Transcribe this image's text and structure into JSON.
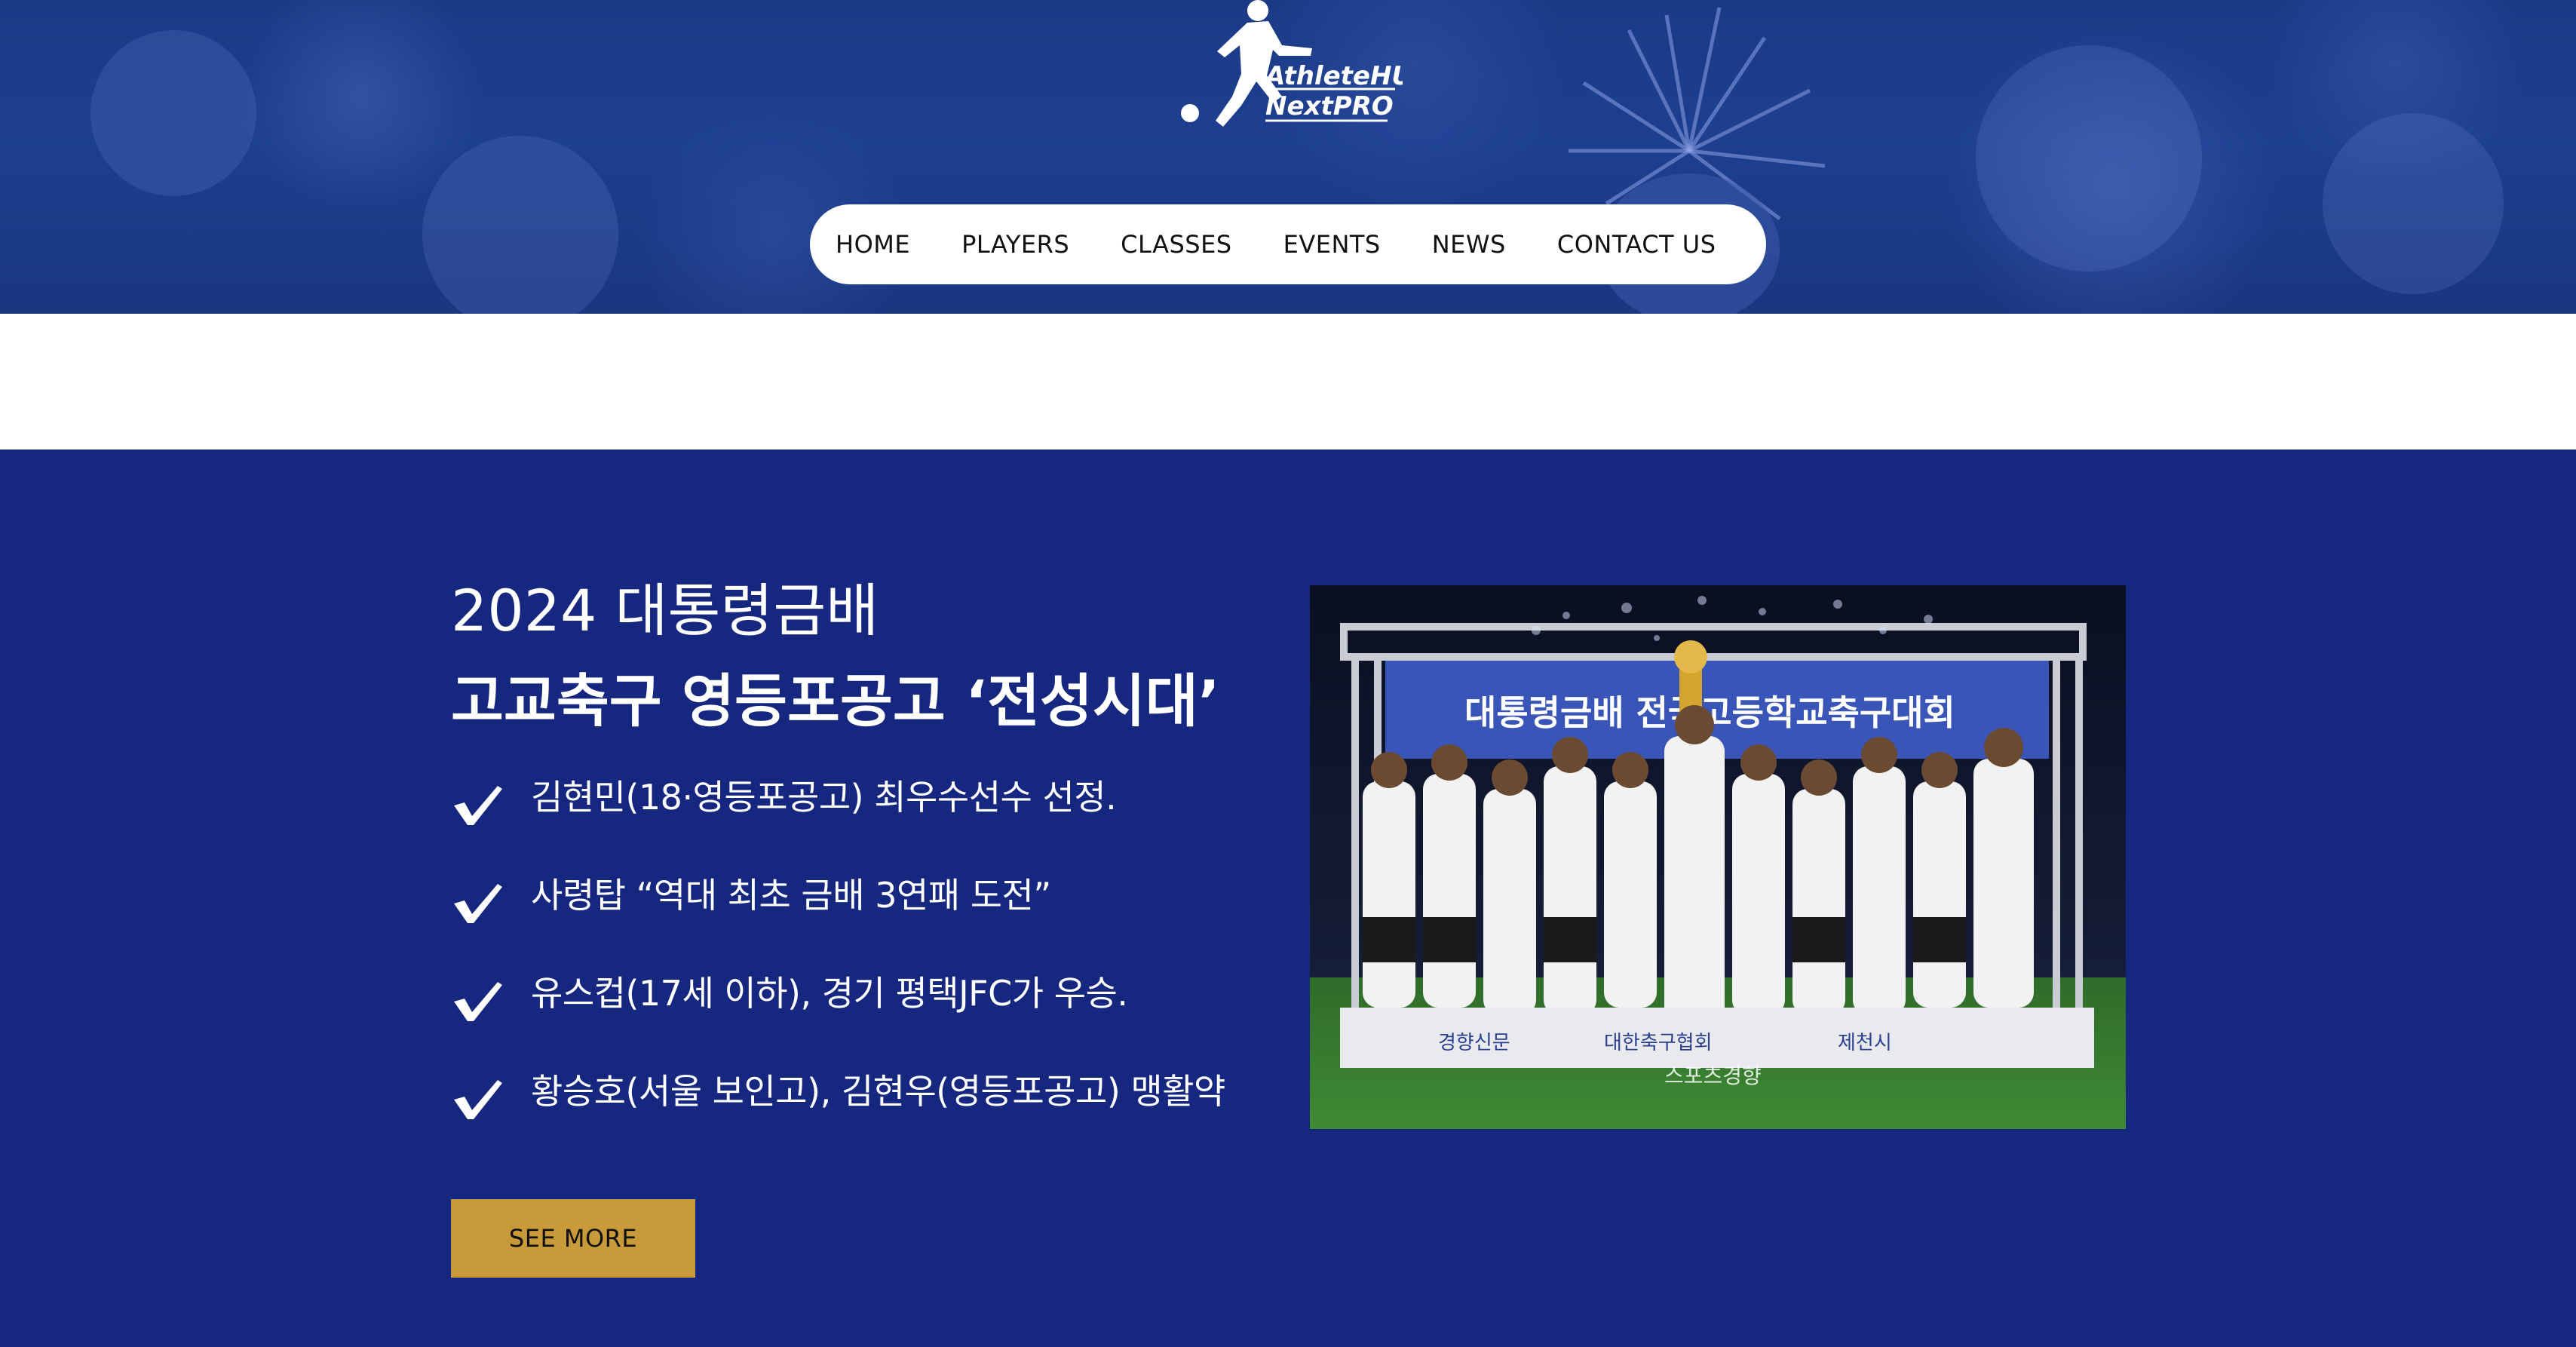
{
  "logo": {
    "line1": "AthleteHUB",
    "line2": "NextPRO"
  },
  "nav": {
    "items": [
      {
        "label": "HOME"
      },
      {
        "label": "PLAYERS"
      },
      {
        "label": "CLASSES"
      },
      {
        "label": "EVENTS"
      },
      {
        "label": "NEWS"
      },
      {
        "label": "CONTACT US"
      }
    ]
  },
  "feature": {
    "title_line1": "2024 대통령금배",
    "title_line2": "고교축구 영등포공고 ‘전성시대’",
    "bullets": [
      {
        "text": "김현민(18·영등포공고) 최우수선수 선정."
      },
      {
        "text": "사령탑 “역대 최초 금배 3연패 도전”"
      },
      {
        "text": "유스컵(17세 이하), 경기 평택JFC가 우승."
      },
      {
        "text": "황승호(서울 보인고), 김현우(영등포공고) 맹활약"
      }
    ],
    "button_label": "SEE MORE",
    "bullet_icon": "check-icon"
  },
  "photo": {
    "banner_text": "대통령금배 전국고등학교축구대회",
    "sponsor_texts": [
      "경향신문",
      "대한축구협회",
      "제천시",
      "스포츠경향"
    ]
  },
  "colors": {
    "header_blue": "#1b3a86",
    "section_blue": "#16277f",
    "button_gold": "#c99a3a",
    "nav_bg": "#ffffff"
  }
}
